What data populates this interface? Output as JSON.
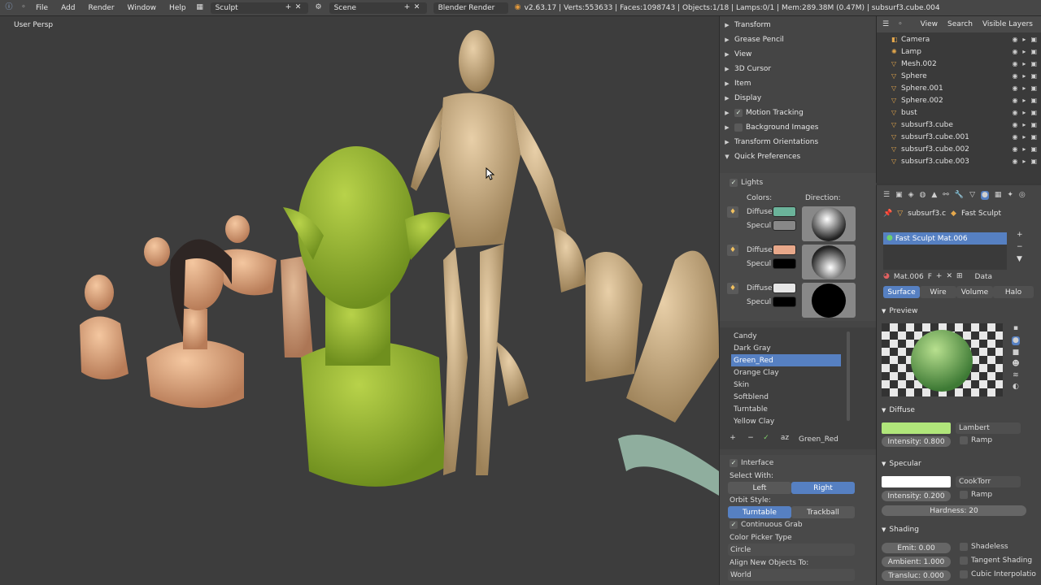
{
  "topbar": {
    "menus": [
      "File",
      "Add",
      "Render",
      "Window",
      "Help"
    ],
    "screen_name": "Sculpt",
    "scene_name": "Scene",
    "render_engine": "Blender Render",
    "stats": "v2.63.17 | Verts:553633 | Faces:1098743 | Objects:1/18 | Lamps:0/1 | Mem:289.38M (0.47M) | subsurf3.cube.004"
  },
  "viewport": {
    "label": "User Persp"
  },
  "properties": {
    "sections": [
      "Transform",
      "Grease Pencil",
      "View",
      "3D Cursor",
      "Item",
      "Display",
      "Motion Tracking",
      "Background Images",
      "Transform Orientations",
      "Quick Preferences"
    ],
    "lights": {
      "title": "Lights",
      "colors_label": "Colors:",
      "direction_label": "Direction:",
      "diffuse_label": "Diffuse",
      "specular_label": "Specul",
      "rows": [
        {
          "diffuse": "#6bb39a",
          "specular": "#888888"
        },
        {
          "diffuse": "#e8a88a",
          "specular": "#000000"
        },
        {
          "diffuse": "#e6e6e6",
          "specular": "#000000"
        }
      ]
    },
    "presets": [
      "Candy",
      "Dark Gray",
      "Green_Red",
      "Orange Clay",
      "Skin",
      "Softblend",
      "Turntable",
      "Yellow Clay"
    ],
    "selected_preset": "Green_Red",
    "preset_name_field": "Green_Red",
    "interface": {
      "title": "Interface",
      "select_with_label": "Select With:",
      "select_left": "Left",
      "select_right": "Right",
      "orbit_label": "Orbit Style:",
      "orbit_turntable": "Turntable",
      "orbit_trackball": "Trackball",
      "continuous_grab": "Continuous Grab",
      "color_picker_label": "Color Picker Type",
      "color_picker_value": "Circle",
      "align_label": "Align New Objects To:",
      "align_value": "World"
    }
  },
  "outliner": {
    "menus": [
      "View",
      "Search",
      "Visible Layers"
    ],
    "items": [
      "Camera",
      "Lamp",
      "Mesh.002",
      "Sphere",
      "Sphere.001",
      "Sphere.002",
      "bust",
      "subsurf3.cube",
      "subsurf3.cube.001",
      "subsurf3.cube.002",
      "subsurf3.cube.003"
    ]
  },
  "material": {
    "breadcrumb_object": "subsurf3.c",
    "breadcrumb_material": "Fast Sculpt",
    "slot_name": "Fast Sculpt Mat.006",
    "mat_name": "Mat.006",
    "mat_flag": "F",
    "data_label": "Data",
    "tabs": [
      "Surface",
      "Wire",
      "Volume",
      "Halo"
    ],
    "preview_title": "Preview",
    "diffuse_title": "Diffuse",
    "diffuse_color": "#b0e67a",
    "diffuse_shader": "Lambert",
    "diffuse_intensity": "Intensity: 0.800",
    "ramp_label": "Ramp",
    "specular_title": "Specular",
    "specular_color": "#ffffff",
    "specular_shader": "CookTorr",
    "specular_intensity": "Intensity: 0.200",
    "hardness": "Hardness: 20",
    "shading_title": "Shading",
    "emit": "Emit: 0.00",
    "ambient": "Ambient: 1.000",
    "translucency": "Transluc: 0.000",
    "shadeless": "Shadeless",
    "tangent_shading": "Tangent Shading",
    "cubic_interp": "Cubic Interpolatio"
  }
}
